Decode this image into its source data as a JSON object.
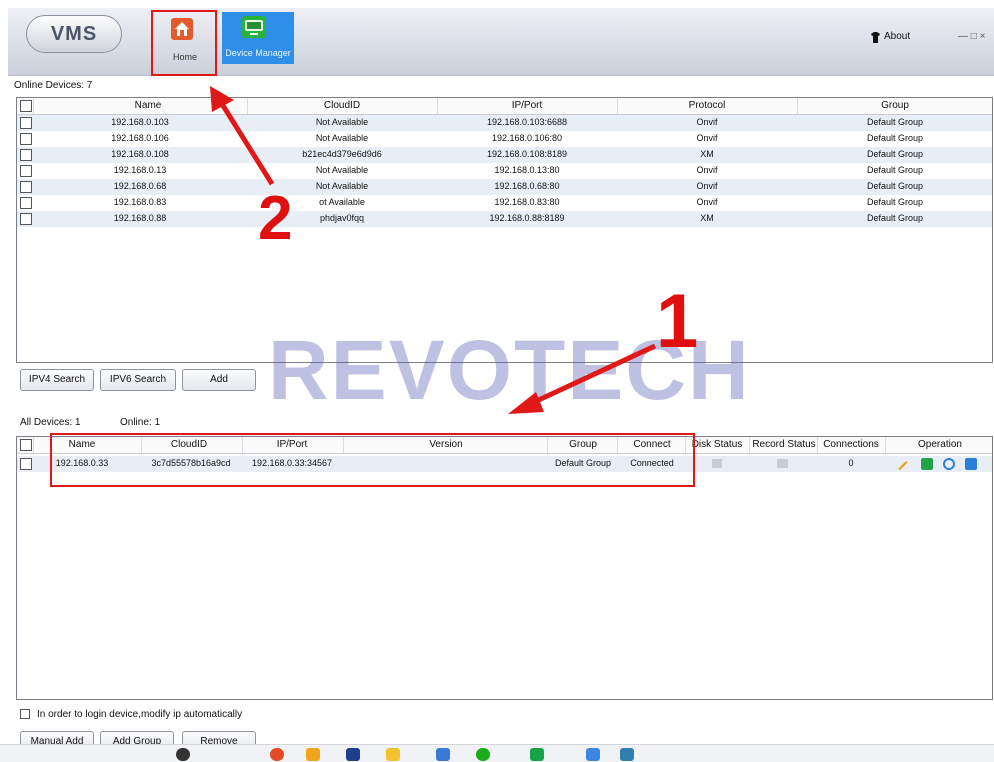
{
  "app": {
    "logo": "VMS",
    "home_label": "Home",
    "device_manager_label": "Device Manager",
    "about_label": "About",
    "window_controls": "— □ ×"
  },
  "online": {
    "label": "Online Devices: 7",
    "columns": [
      "Name",
      "CloudID",
      "IP/Port",
      "Protocol",
      "Group"
    ],
    "rows": [
      {
        "name": "192.168.0.103",
        "cloudid": "Not Available",
        "ip": "192.168.0.103:6688",
        "protocol": "Onvif",
        "group": "Default Group"
      },
      {
        "name": "192.168.0.106",
        "cloudid": "Not Available",
        "ip": "192.168.0.106:80",
        "protocol": "Onvif",
        "group": "Default Group"
      },
      {
        "name": "192.168.0.108",
        "cloudid": "b21ec4d379e6d9d6",
        "ip": "192.168.0.108:8189",
        "protocol": "XM",
        "group": "Default Group"
      },
      {
        "name": "192.168.0.13",
        "cloudid": "Not Available",
        "ip": "192.168.0.13:80",
        "protocol": "Onvif",
        "group": "Default Group"
      },
      {
        "name": "192.168.0.68",
        "cloudid": "Not Available",
        "ip": "192.168.0.68:80",
        "protocol": "Onvif",
        "group": "Default Group"
      },
      {
        "name": "192.168.0.83",
        "cloudid": "ot Available",
        "ip": "192.168.0.83:80",
        "protocol": "Onvif",
        "group": "Default Group"
      },
      {
        "name": "192.168.0.88",
        "cloudid": "phdjav0fqq",
        "ip": "192.168.0.88:8189",
        "protocol": "XM",
        "group": "Default Group"
      }
    ]
  },
  "search_buttons": {
    "ipv4": "IPV4 Search",
    "ipv6": "IPV6 Search",
    "add": "Add"
  },
  "watermark": "REVOTECH",
  "annotations": {
    "one": "1",
    "two": "2"
  },
  "all": {
    "all_devices_label": "All Devices:  1",
    "online_label": "Online:  1",
    "columns": [
      "Name",
      "CloudID",
      "IP/Port",
      "Version",
      "Group",
      "Connect",
      "Disk Status",
      "Record Status",
      "Connections",
      "Operation"
    ],
    "rows": [
      {
        "name": "192.168.0.33",
        "cloudid": "3c7d55578b16a9cd",
        "ip": "192.168.0.33:34567",
        "version": "",
        "group": "Default Group",
        "connect": "Connected",
        "connections": "0"
      }
    ]
  },
  "auto_ip_label": "In order to login device,modify ip automatically",
  "bottom_buttons": {
    "manual_add": "Manual Add",
    "add_group": "Add Group",
    "remove": "Remove"
  },
  "colors": {
    "accent": "#2f8fe8",
    "annotation": "#e01818",
    "home": "#e55a2a"
  }
}
